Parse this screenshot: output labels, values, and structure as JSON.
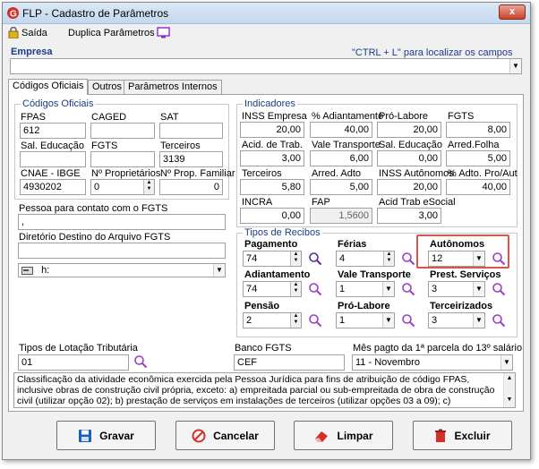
{
  "window": {
    "title": "FLP - Cadastro de Parâmetros",
    "close": "x"
  },
  "toolbar": {
    "exit": "Saída",
    "duplicate": "Duplica Parâmetros"
  },
  "empresa": {
    "label": "Empresa",
    "hint": "\"CTRL + L\" para localizar os campos",
    "value": ""
  },
  "tabs": [
    "Códigos Oficiais",
    "Outros",
    "Parâmetros Internos"
  ],
  "codigos": {
    "title": "Códigos Oficiais",
    "fpas": {
      "label": "FPAS",
      "value": "612"
    },
    "caged": {
      "label": "CAGED",
      "value": ""
    },
    "sat": {
      "label": "SAT",
      "value": ""
    },
    "sal_educacao": {
      "label": "Sal. Educação",
      "value": ""
    },
    "fgts": {
      "label": "FGTS",
      "value": ""
    },
    "terceiros": {
      "label": "Terceiros",
      "value": "3139"
    },
    "cnae": {
      "label": "CNAE - IBGE",
      "value": "4930202"
    },
    "n_proprietarios": {
      "label": "Nº Proprietários",
      "value": "0"
    },
    "n_prop_familiar": {
      "label": "Nº Prop. Familiar",
      "value": "0"
    }
  },
  "pessoa_contato": {
    "label": "Pessoa para contato com o FGTS",
    "value": ","
  },
  "diretorio": {
    "label": "Diretório Destino do Arquivo FGTS",
    "value": "",
    "drive": "h:"
  },
  "indicadores": {
    "title": "Indicadores",
    "items": [
      {
        "label": "INSS Empresa",
        "value": "20,00"
      },
      {
        "label": "% Adiantamento",
        "value": "40,00"
      },
      {
        "label": "Pró-Labore",
        "value": "20,00"
      },
      {
        "label": "FGTS",
        "value": "8,00"
      },
      {
        "label": "Acid. de Trab.",
        "value": "3,00"
      },
      {
        "label": "Vale Transporte",
        "value": "6,00"
      },
      {
        "label": "Sal. Educação",
        "value": "0,00"
      },
      {
        "label": "Arred.Folha",
        "value": "5,00"
      },
      {
        "label": "Terceiros",
        "value": "5,80"
      },
      {
        "label": "Arred. Adto",
        "value": "5,00"
      },
      {
        "label": "INSS Autônomos",
        "value": "20,00"
      },
      {
        "label": "% Adto. Pro/Aut",
        "value": "40,00"
      },
      {
        "label": "INCRA",
        "value": "0,00"
      },
      {
        "label": "FAP",
        "value": "1,5600"
      },
      {
        "label": "Acid Trab eSocial",
        "value": "3,00"
      }
    ]
  },
  "recibos": {
    "title": "Tipos de Recibos",
    "pagamento": {
      "label": "Pagamento",
      "value": "74"
    },
    "ferias": {
      "label": "Férias",
      "value": "4"
    },
    "autonomos": {
      "label": "Autônomos",
      "value": "12"
    },
    "adiantamento": {
      "label": "Adiantamento",
      "value": "74"
    },
    "vale_transporte": {
      "label": "Vale Transporte",
      "value": "1"
    },
    "prest_servicos": {
      "label": "Prest. Serviços",
      "value": "3"
    },
    "pensao": {
      "label": "Pensão",
      "value": "2"
    },
    "pro_labore": {
      "label": "Pró-Labore",
      "value": "1"
    },
    "terceirizados": {
      "label": "Terceirizados",
      "value": "3"
    }
  },
  "lotacao": {
    "label": "Tipos de Lotação Tributária",
    "value": "01"
  },
  "banco": {
    "label": "Banco FGTS",
    "value": "CEF"
  },
  "mes13": {
    "label": "Mês pagto da 1ª parcela do 13º salário",
    "value": "11 -  Novembro"
  },
  "descricao": "Classificação da atividade econômica exercida pela Pessoa Jurídica para fins de atribuição de código FPAS, inclusive obras de construção civil própria, exceto: a) empreitada parcial ou sub-empreitada de obra de construção civil (utilizar opção 02); b) prestação de serviços em instalações de terceiros (utilizar opções 03 a 09); c) Embarcação inscrita no Registro Especial",
  "buttons": {
    "gravar": "Gravar",
    "cancelar": "Cancelar",
    "limpar": "Limpar",
    "excluir": "Excluir"
  },
  "colors": {
    "highlight": "#d9534f",
    "group_title": "#1a3c8a",
    "magnifier": "#9b3fc8"
  }
}
